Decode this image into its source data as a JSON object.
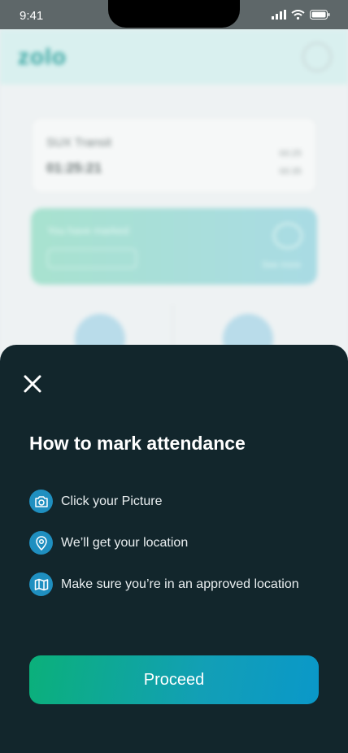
{
  "status_bar": {
    "time": "9:41"
  },
  "background": {
    "logo": "zolo",
    "card_title": "SUX Transit",
    "card_value": "01:25:21",
    "card_right_1": "00:25",
    "card_right_2": "00:35",
    "green_title": "You have marked",
    "green_link": "See more"
  },
  "sheet": {
    "title": "How to mark attendance",
    "steps": [
      {
        "icon": "camera-icon",
        "text": "Click your Picture"
      },
      {
        "icon": "location-pin-icon",
        "text": "We’ll get your location"
      },
      {
        "icon": "map-icon",
        "text": "Make sure you’re in an approved location"
      }
    ],
    "proceed_label": "Proceed"
  },
  "colors": {
    "sheet_bg": "#12262c",
    "icon_bg": "#1f8fc0",
    "button_gradient_start": "#0bb07a",
    "button_gradient_end": "#0a98c9"
  }
}
